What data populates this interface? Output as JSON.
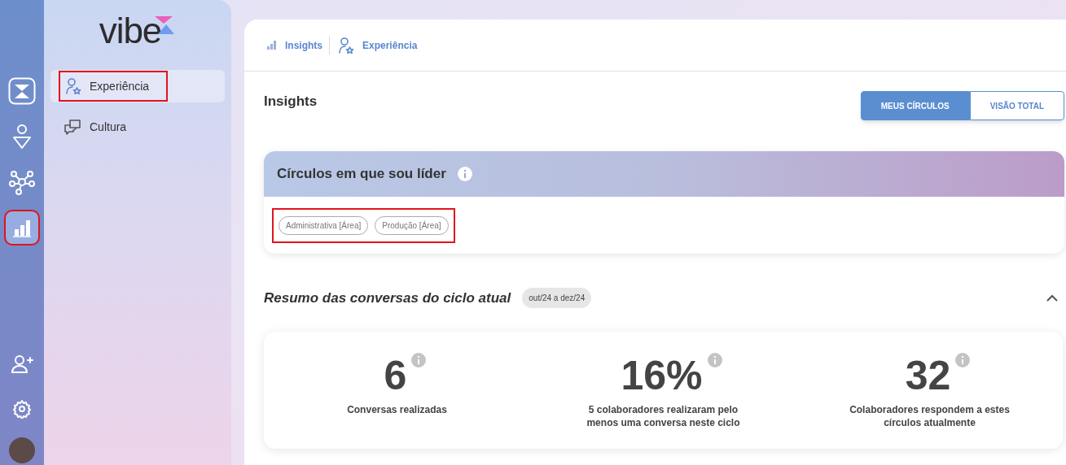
{
  "rail": {
    "top_items": [
      {
        "kind": "app",
        "selected": false,
        "highlighted": false
      },
      {
        "kind": "ai",
        "selected": false,
        "highlighted": false
      },
      {
        "kind": "network",
        "selected": false,
        "highlighted": false
      },
      {
        "kind": "chart",
        "selected": true,
        "highlighted": true
      }
    ],
    "bottom_items": [
      {
        "kind": "add_user",
        "selected": false,
        "highlighted": false
      },
      {
        "kind": "settings",
        "selected": false,
        "highlighted": false
      }
    ]
  },
  "sidebar": {
    "logo": "vibe",
    "items": [
      {
        "kind": "experience",
        "label": "Experiência",
        "selected": true,
        "highlighted": true
      },
      {
        "kind": "culture",
        "label": "Cultura",
        "selected": false,
        "highlighted": false
      }
    ]
  },
  "breadcrumb": [
    {
      "kind": "chart",
      "label": "Insights"
    },
    {
      "kind": "experience",
      "label": "Experiência"
    }
  ],
  "page_title": "Insights",
  "view_toggle": [
    {
      "label": "MEUS CÍRCULOS",
      "selected": true
    },
    {
      "label": "VISÃO TOTAL",
      "selected": false
    }
  ],
  "circles_card": {
    "title": "Círculos em que sou líder",
    "highlighted": true,
    "tags": [
      "Administrativa [Área]",
      "Produção [Área]"
    ]
  },
  "summary": {
    "title": "Resumo das conversas do ciclo atual",
    "period": "out/24 a dez/24",
    "expanded": true,
    "stats": [
      {
        "value": "6",
        "label": "Conversas realizadas"
      },
      {
        "value": "16%",
        "label": "5 colaboradores realizaram pelo menos uma conversa neste ciclo"
      },
      {
        "value": "32",
        "label": "Colaboradores respondem a estes círculos atualmente"
      }
    ]
  }
}
